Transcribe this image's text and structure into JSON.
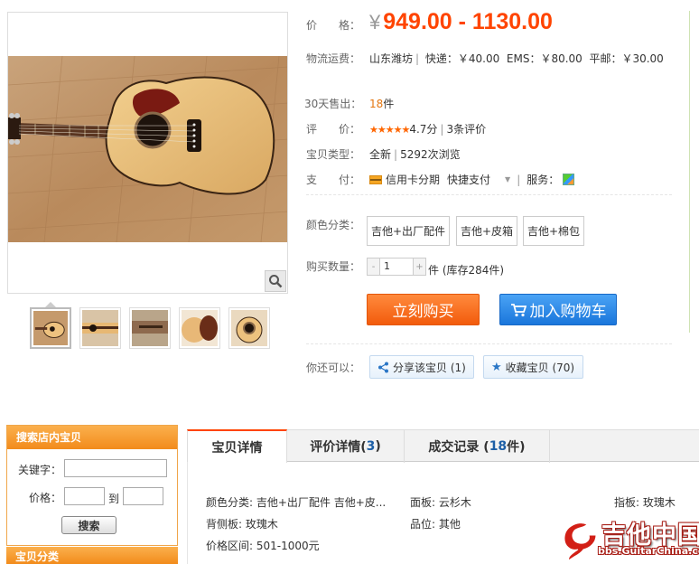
{
  "product": {
    "price_label": "价　　格：",
    "price_currency": "¥",
    "price_range": "949.00 - 1130.00",
    "shipping_label": "物流运费：",
    "shipping_origin": "山东潍坊",
    "shipping_express": "快递：￥40.00",
    "shipping_ems": "EMS：￥80.00",
    "shipping_regular": "平邮：￥30.00",
    "sold_label": "30天售出：",
    "sold_count": "18",
    "sold_unit": "件",
    "rating_label": "评　　价：",
    "rating_stars": "★★★★★",
    "rating_score": "4.7分",
    "rating_reviews": "3条评价",
    "type_label": "宝贝类型：",
    "type_value": "全新",
    "type_views": "5292次浏览",
    "pay_label": "支　　付：",
    "pay_installment": "信用卡分期",
    "pay_quick": "快捷支付",
    "service_label": "服务：",
    "color_label": "颜色分类：",
    "sku_options": [
      "吉他+出厂配件",
      "吉他+皮箱",
      "吉他+棉包"
    ],
    "quantity_label": "购买数量：",
    "quantity_value": "1",
    "quantity_minus": "-",
    "quantity_plus": "+",
    "stock_text": "件 (库存284件)",
    "buy_now_label": "立刻购买",
    "add_cart_label": "加入购物车",
    "also_label": "你还可以：",
    "share_label": "分享该宝贝 (1)",
    "favorite_label": "收藏宝贝 (70)"
  },
  "shop_search": {
    "title": "搜索店内宝贝",
    "keyword_label": "关键字：",
    "price_label": "价格：",
    "to_label": "到",
    "search_button": "搜索",
    "category_title": "宝贝分类"
  },
  "detail_tabs": {
    "tab1": "宝贝详情",
    "tab2_text": "评价详情(",
    "tab2_count": "3",
    "tab2_close": ")",
    "tab3_text": "成交记录 (",
    "tab3_count": "18",
    "tab3_unit": "件)"
  },
  "attributes": {
    "color": "颜色分类: 吉他+出厂配件 吉他+皮...",
    "top": "面板: 云杉木",
    "fingerboard": "指板: 玫瑰木",
    "back_side": "背侧板: 玫瑰木",
    "brand": "品位: 其他",
    "price_range": "价格区间: 501-1000元"
  },
  "watermark": {
    "title": "吉他中国",
    "url": "bbs.GuitarChina.com"
  },
  "colors": {
    "price": "#ff4400",
    "buy": "#f25b0c",
    "cart": "#1a76db",
    "search_header": "#f28b1b"
  }
}
